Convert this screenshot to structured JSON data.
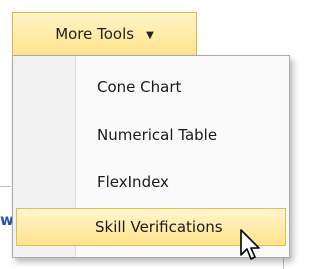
{
  "toolbar": {
    "more_tools_label": "More Tools",
    "caret_glyph": "▼"
  },
  "menu": {
    "items": [
      {
        "label": "Cone Chart"
      },
      {
        "label": "Numerical Table"
      },
      {
        "label": "FlexIndex"
      },
      {
        "label": "Skill Verifications"
      }
    ],
    "highlighted_item": "Skill Verifications"
  },
  "background": {
    "partial_text": "w"
  },
  "colors": {
    "button_bg_top": "#fff4c6",
    "button_bg_bottom": "#ffe48c",
    "button_border": "#d9b84a",
    "highlight_border": "#e0bf51",
    "menu_border": "#a7abb0",
    "menu_bg": "#fafafa",
    "gutter_bg": "#f1f1f1",
    "link_text": "#2a51a8"
  },
  "icons": {
    "cursor": "mouse-pointer-icon",
    "caret": "caret-down-icon"
  }
}
